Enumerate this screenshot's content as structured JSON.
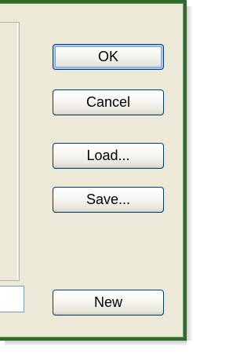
{
  "buttons": {
    "ok": "OK",
    "cancel": "Cancel",
    "load": "Load...",
    "save": "Save...",
    "new": "New"
  },
  "name_field": {
    "value": ""
  },
  "colors": {
    "frame_border": "#2e6b2c",
    "dialog_background": "#ece9d8",
    "button_border": "#003c74",
    "default_button_focus": "#7ba2e2"
  }
}
